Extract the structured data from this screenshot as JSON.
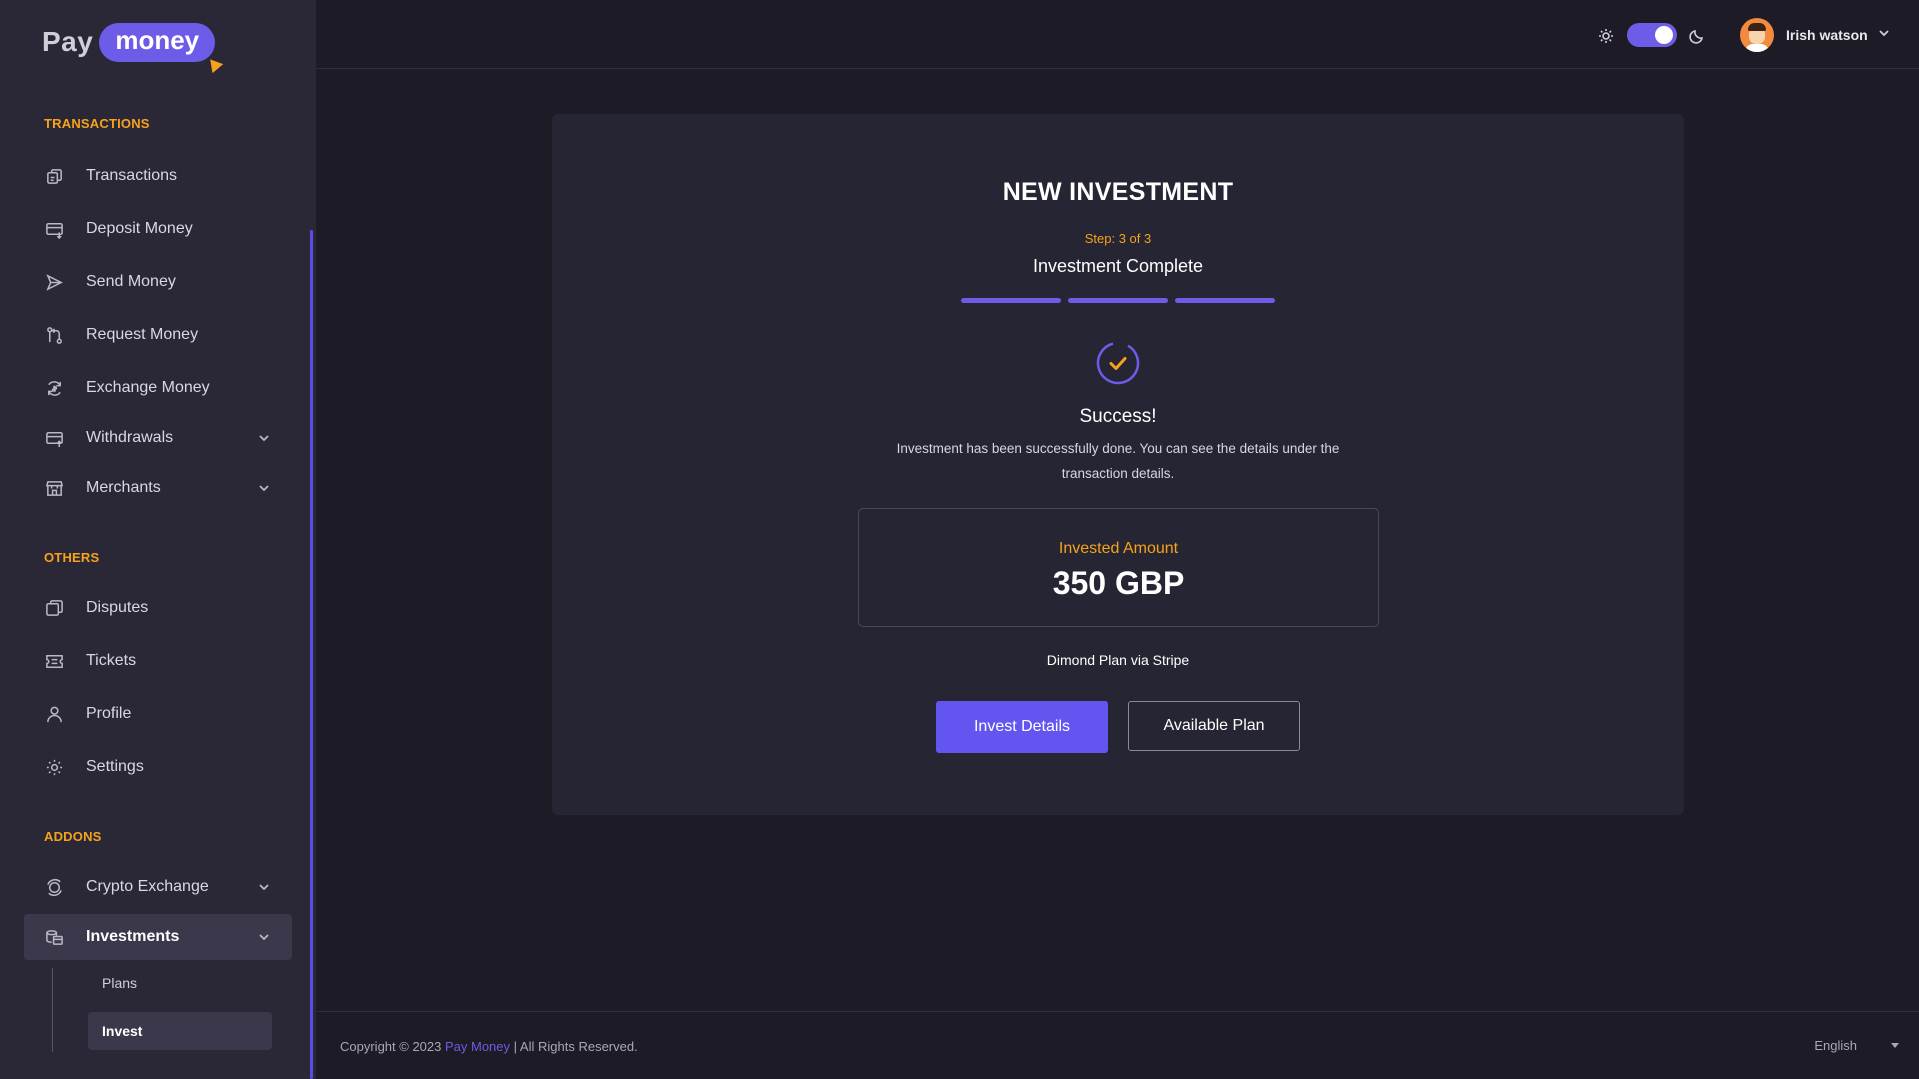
{
  "logo": {
    "part1": "Pay",
    "part2": "money"
  },
  "sidebar": {
    "sections": {
      "transactions": "TRANSACTIONS",
      "others": "OTHERS",
      "addons": "ADDONS"
    },
    "items": [
      {
        "label": "Transactions",
        "icon": "transactions-icon"
      },
      {
        "label": "Deposit Money",
        "icon": "deposit-icon"
      },
      {
        "label": "Send Money",
        "icon": "send-icon"
      },
      {
        "label": "Request Money",
        "icon": "request-icon"
      },
      {
        "label": "Exchange Money",
        "icon": "exchange-icon"
      },
      {
        "label": "Withdrawals",
        "icon": "withdraw-icon"
      },
      {
        "label": "Merchants",
        "icon": "merchant-icon"
      },
      {
        "label": "Disputes",
        "icon": "disputes-icon"
      },
      {
        "label": "Tickets",
        "icon": "ticket-icon"
      },
      {
        "label": "Profile",
        "icon": "user-icon"
      },
      {
        "label": "Settings",
        "icon": "gear-icon"
      },
      {
        "label": "Crypto Exchange",
        "icon": "crypto-icon"
      },
      {
        "label": "Investments",
        "icon": "investments-icon"
      }
    ],
    "sub_items": [
      {
        "label": "Plans"
      },
      {
        "label": "Invest"
      }
    ]
  },
  "topbar": {
    "user_name": "Irish watson",
    "theme": "dark"
  },
  "card": {
    "title": "NEW INVESTMENT",
    "step_label": "Step: 3 of 3",
    "step_title": "Investment Complete",
    "progress": {
      "current": 3,
      "total": 3
    },
    "success_title": "Success!",
    "success_message": "Investment has been successfully done. You can see the details under the transaction details.",
    "amount_label": "Invested Amount",
    "amount_value": "350 GBP",
    "plan_via": "Dimond Plan via Stripe",
    "primary_button": "Invest Details",
    "secondary_button": "Available Plan"
  },
  "footer": {
    "copyright_prefix": "Copyright © 2023",
    "brand_link": "Pay Money",
    "copyright_suffix": "| All Rights Reserved.",
    "language": "English"
  },
  "colors": {
    "accent": "#6c5ce7",
    "orange": "#f7a21b",
    "background": "#1c1b26",
    "sidebar": "#2a2837",
    "card": "#262533"
  }
}
